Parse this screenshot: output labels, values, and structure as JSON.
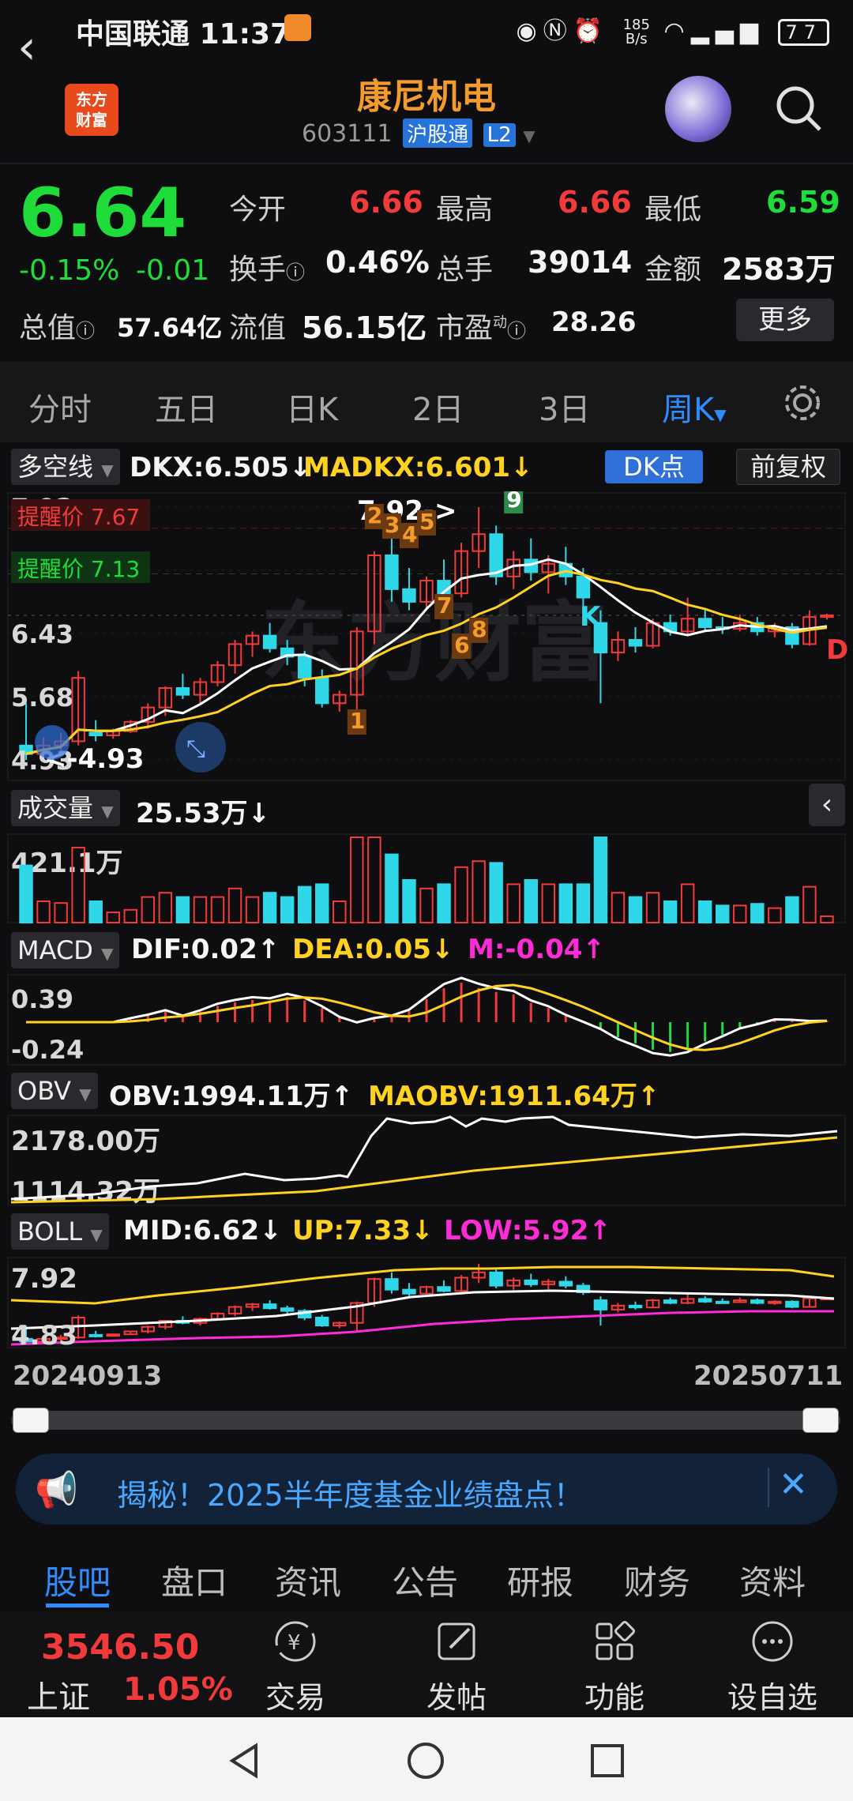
{
  "status_bar": {
    "carrier": "中国联通",
    "time": "11:37",
    "net_speed_top": "185",
    "net_speed_unit": "B/s",
    "battery": "77"
  },
  "header": {
    "back_icon": "chevron-left-icon",
    "logo_top": "东方",
    "logo_bottom": "财富",
    "title": "康尼机电",
    "code": "603111",
    "exchange_tag": "沪股通",
    "level_tag": "L2",
    "avatar_icon": "robot-avatar-icon",
    "search_icon": "search-icon"
  },
  "quote": {
    "price": "6.64",
    "change_pct": "-0.15%",
    "change": "-0.01",
    "open_label": "今开",
    "open": "6.66",
    "high_label": "最高",
    "high": "6.66",
    "low_label": "最低",
    "low": "6.59",
    "turnover_label": "换手",
    "turnover": "0.46%",
    "volume_label": "总手",
    "volume": "39014",
    "amount_label": "金额",
    "amount": "2583万",
    "mcap_label": "总值",
    "mcap": "57.64亿",
    "float_label": "流值",
    "float": "56.15亿",
    "pe_label": "市盈",
    "pe_sup": "动",
    "pe": "28.26",
    "more_label": "更多"
  },
  "tabs": {
    "items": [
      "分时",
      "五日",
      "日K",
      "2日",
      "3日",
      "周K"
    ],
    "active": "周K",
    "settings_icon": "gear-icon"
  },
  "main_chart": {
    "indicator": "多空线",
    "dkx": "DKX:6.505↓",
    "madkx": "MADKX:6.601↓",
    "dk_button": "DK点",
    "adjust_button": "前复权",
    "y_labels": [
      "7.92",
      "7.17",
      "6.43",
      "5.68",
      "4.93"
    ],
    "alert_high": "提醒价 7.67",
    "alert_low": "提醒价 7.13",
    "max_marker": "7.92->",
    "min_marker": "<-4.93",
    "seq_labels": [
      "1",
      "2",
      "3",
      "4",
      "5",
      "6",
      "7",
      "8",
      "9"
    ],
    "k_marker": "K",
    "d_marker": "D",
    "colors": {
      "up": "#f23a3a",
      "down": "#2fd8e8",
      "dkx": "#ffffff",
      "madkx": "#ffd21f"
    }
  },
  "volume_panel": {
    "indicator": "成交量",
    "value": "25.53万↓",
    "y_label": "421.1万"
  },
  "macd_panel": {
    "indicator": "MACD",
    "dif": "DIF:0.02↑",
    "dea": "DEA:0.05↓",
    "m": "M:-0.04↑",
    "y_top": "0.39",
    "y_bottom": "-0.24"
  },
  "obv_panel": {
    "indicator": "OBV",
    "obv": "OBV:1994.11万↑",
    "maobv": "MAOBV:1911.64万↑",
    "y_top": "2178.00万",
    "y_bottom": "1114.32万"
  },
  "boll_panel": {
    "indicator": "BOLL",
    "mid": "MID:6.62↓",
    "up": "UP:7.33↓",
    "low": "LOW:5.92↑",
    "y_top": "7.92",
    "y_bottom": "4.83"
  },
  "date_range": {
    "start": "20240913",
    "end": "20250711"
  },
  "banner": {
    "text": "揭秘！2025半年度基金业绩盘点！",
    "icon": "megaphone-icon",
    "close_icon": "close-icon"
  },
  "bottom_tabs": {
    "items": [
      "股吧",
      "盘口",
      "资讯",
      "公告",
      "研报",
      "财务",
      "资料"
    ],
    "active": "股吧"
  },
  "footer": {
    "index_value": "3546.50",
    "index_name": "上证",
    "index_pct": "1.05%",
    "buttons": [
      {
        "label": "交易",
        "icon": "yuan-cycle-icon"
      },
      {
        "label": "发帖",
        "icon": "edit-icon"
      },
      {
        "label": "功能",
        "icon": "grid-icon"
      },
      {
        "label": "设自选",
        "icon": "more-circle-icon"
      }
    ]
  },
  "chart_data": {
    "type": "candlestick",
    "period": "weekly",
    "x_start": "20240913",
    "x_end": "20250711",
    "ylim": [
      4.93,
      7.92
    ],
    "candles": [
      [
        5.1,
        5.6,
        4.93,
        5.0
      ],
      [
        5.0,
        5.2,
        4.95,
        5.1
      ],
      [
        5.1,
        5.25,
        5.02,
        5.15
      ],
      [
        5.15,
        5.98,
        5.1,
        5.9
      ],
      [
        5.25,
        5.4,
        5.15,
        5.22
      ],
      [
        5.22,
        5.3,
        5.18,
        5.27
      ],
      [
        5.27,
        5.4,
        5.25,
        5.38
      ],
      [
        5.38,
        5.6,
        5.3,
        5.55
      ],
      [
        5.55,
        5.8,
        5.45,
        5.78
      ],
      [
        5.78,
        5.95,
        5.65,
        5.7
      ],
      [
        5.7,
        5.9,
        5.6,
        5.85
      ],
      [
        5.85,
        6.1,
        5.8,
        6.05
      ],
      [
        6.05,
        6.35,
        5.95,
        6.3
      ],
      [
        6.3,
        6.45,
        6.15,
        6.4
      ],
      [
        6.4,
        6.55,
        6.2,
        6.25
      ],
      [
        6.25,
        6.35,
        6.05,
        6.15
      ],
      [
        6.15,
        6.22,
        5.8,
        5.9
      ],
      [
        5.9,
        6.0,
        5.55,
        5.6
      ],
      [
        5.6,
        5.75,
        5.5,
        5.7
      ],
      [
        5.7,
        6.5,
        5.4,
        6.45
      ],
      [
        6.45,
        7.4,
        6.3,
        7.35
      ],
      [
        7.35,
        7.6,
        6.8,
        6.95
      ],
      [
        6.95,
        7.2,
        6.7,
        6.8
      ],
      [
        6.8,
        7.1,
        6.7,
        7.05
      ],
      [
        7.05,
        7.3,
        6.85,
        6.9
      ],
      [
        6.9,
        7.5,
        6.85,
        7.4
      ],
      [
        7.4,
        7.92,
        7.2,
        7.6
      ],
      [
        7.6,
        7.7,
        7.0,
        7.1
      ],
      [
        7.1,
        7.4,
        6.95,
        7.3
      ],
      [
        7.3,
        7.55,
        7.05,
        7.15
      ],
      [
        7.15,
        7.35,
        6.9,
        7.25
      ],
      [
        7.25,
        7.45,
        7.0,
        7.1
      ],
      [
        7.1,
        7.2,
        6.75,
        6.85
      ],
      [
        6.55,
        6.7,
        5.6,
        6.2
      ],
      [
        6.2,
        6.45,
        6.1,
        6.35
      ],
      [
        6.35,
        6.5,
        6.2,
        6.28
      ],
      [
        6.28,
        6.6,
        6.25,
        6.55
      ],
      [
        6.55,
        6.65,
        6.4,
        6.45
      ],
      [
        6.45,
        6.85,
        6.4,
        6.6
      ],
      [
        6.6,
        6.7,
        6.45,
        6.5
      ],
      [
        6.5,
        6.62,
        6.42,
        6.48
      ],
      [
        6.48,
        6.65,
        6.45,
        6.55
      ],
      [
        6.55,
        6.62,
        6.4,
        6.45
      ],
      [
        6.45,
        6.55,
        6.38,
        6.5
      ],
      [
        6.5,
        6.55,
        6.25,
        6.3
      ],
      [
        6.3,
        6.7,
        6.28,
        6.62
      ],
      [
        6.62,
        6.66,
        6.59,
        6.64
      ]
    ]
  }
}
